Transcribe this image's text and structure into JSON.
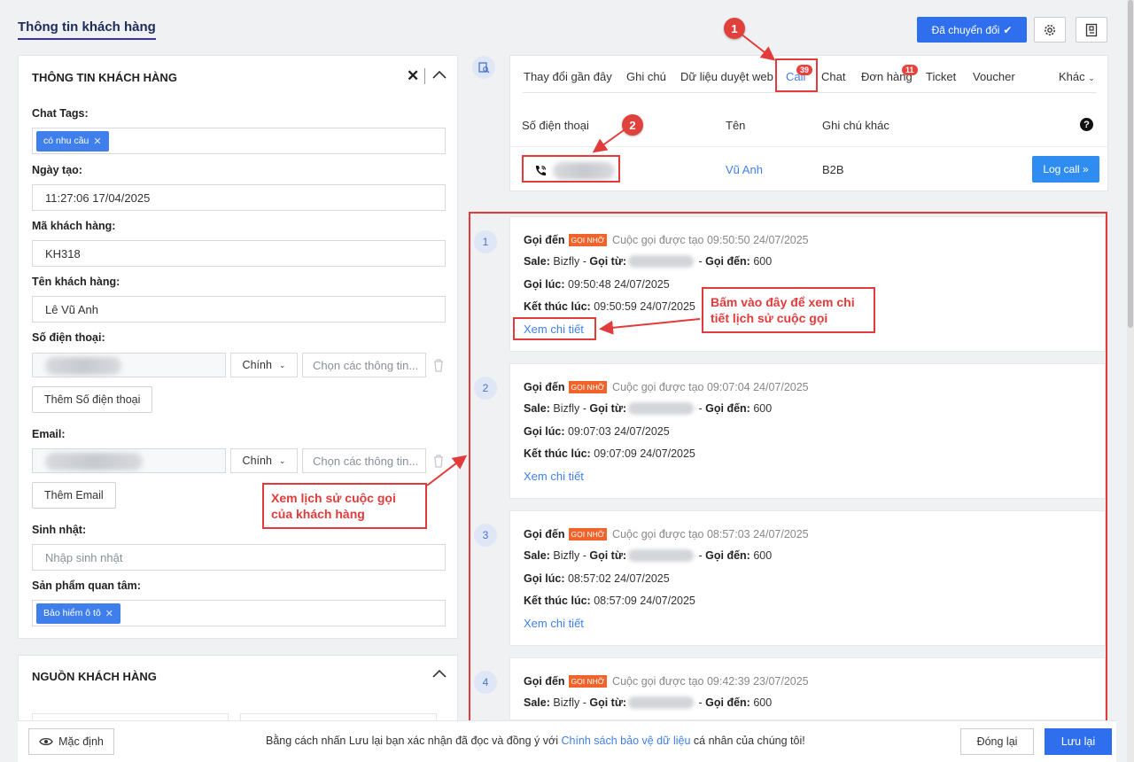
{
  "header": {
    "title": "Thông tin khách hàng",
    "converted_label": "Đã chuyển đổi",
    "icons": [
      "gear-icon",
      "document-icon"
    ]
  },
  "customer": {
    "section_title": "THÔNG TIN KHÁCH HÀNG",
    "chat_tags_label": "Chat Tags:",
    "chat_tag": "có nhu cầu",
    "created_label": "Ngày tạo:",
    "created_value": "11:27:06 17/04/2025",
    "code_label": "Mã khách hàng:",
    "code_value": "KH318",
    "name_label": "Tên khách hàng:",
    "name_value": "Lê Vũ Anh",
    "phone_label": "Số điện thoại:",
    "phone_type": "Chính",
    "phone_info_placeholder": "Chọn các thông tin...",
    "add_phone": "Thêm Số điện thoại",
    "email_label": "Email:",
    "email_type": "Chính",
    "email_info_placeholder": "Chọn các thông tin...",
    "add_email": "Thêm Email",
    "birthday_label": "Sinh nhật:",
    "birthday_placeholder": "Nhập sinh nhật",
    "product_label": "Sản phẩm quan tâm:",
    "product_tag": "Bảo hiểm ô tô"
  },
  "source": {
    "section_title": "NGUỒN KHÁCH HÀNG"
  },
  "tabs": [
    {
      "label": "Thay đổi gần đây"
    },
    {
      "label": "Ghi chú"
    },
    {
      "label": "Dữ liệu duyệt web"
    },
    {
      "label": "Call",
      "badge": "39"
    },
    {
      "label": "Chat"
    },
    {
      "label": "Đơn hàng",
      "badge": "11"
    },
    {
      "label": "Ticket"
    },
    {
      "label": "Voucher"
    },
    {
      "label": "Khác"
    }
  ],
  "call_table": {
    "col_phone": "Số điện thoại",
    "col_name": "Tên",
    "col_note": "Ghi chú khác",
    "help": "?",
    "name": "Vũ Anh",
    "note": "B2B",
    "log_call": "Log call »"
  },
  "calls": [
    {
      "num": "1",
      "type": "Gọi đến",
      "badge": "GỌI NHỠ",
      "created": "Cuộc gọi được tạo 09:50:50 24/07/2025",
      "sale_label": "Sale:",
      "sale": "Bizfly",
      "from_label": "Gọi từ:",
      "to_label": "Gọi đến:",
      "to": "600",
      "at_label": "Gọi lúc:",
      "at": "09:50:48 24/07/2025",
      "end_label": "Kết thúc lúc:",
      "end": "09:50:59 24/07/2025",
      "link": "Xem chi tiết"
    },
    {
      "num": "2",
      "type": "Gọi đến",
      "badge": "GỌI NHỠ",
      "created": "Cuộc gọi được tạo 09:07:04 24/07/2025",
      "sale_label": "Sale:",
      "sale": "Bizfly",
      "from_label": "Gọi từ:",
      "to_label": "Gọi đến:",
      "to": "600",
      "at_label": "Gọi lúc:",
      "at": "09:07:03 24/07/2025",
      "end_label": "Kết thúc lúc:",
      "end": "09:07:09 24/07/2025",
      "link": "Xem chi tiết"
    },
    {
      "num": "3",
      "type": "Gọi đến",
      "badge": "GỌI NHỠ",
      "created": "Cuộc gọi được tạo 08:57:03 24/07/2025",
      "sale_label": "Sale:",
      "sale": "Bizfly",
      "from_label": "Gọi từ:",
      "to_label": "Gọi đến:",
      "to": "600",
      "at_label": "Gọi lúc:",
      "at": "08:57:02 24/07/2025",
      "end_label": "Kết thúc lúc:",
      "end": "08:57:09 24/07/2025",
      "link": "Xem chi tiết"
    },
    {
      "num": "4",
      "type": "Gọi đến",
      "badge": "GỌI NHỠ",
      "created": "Cuộc gọi được tạo 09:42:39 23/07/2025",
      "sale_label": "Sale:",
      "sale": "Bizfly",
      "from_label": "Gọi từ:",
      "to_label": "Gọi đến:",
      "to": "600"
    }
  ],
  "annotations": {
    "marker1": "1",
    "marker2": "2",
    "callout_detail": "Bấm vào đây để xem chi tiết lịch sử cuộc gọi",
    "callout_history": "Xem lịch sử cuộc gọi của khách hàng",
    "color": "#e23b3b"
  },
  "footer": {
    "default_label": "Mặc định",
    "consent_prefix": "Bằng cách nhấn Lưu lại bạn xác nhận đã đọc và đồng ý với ",
    "consent_link": "Chính sách bảo vệ dữ liệu",
    "consent_suffix": " cá nhân của chúng tôi!",
    "close_label": "Đóng lại",
    "save_label": "Lưu lại"
  },
  "colors": {
    "primary": "#2f6fed",
    "link": "#3f7fec",
    "missed": "#f0642c"
  }
}
